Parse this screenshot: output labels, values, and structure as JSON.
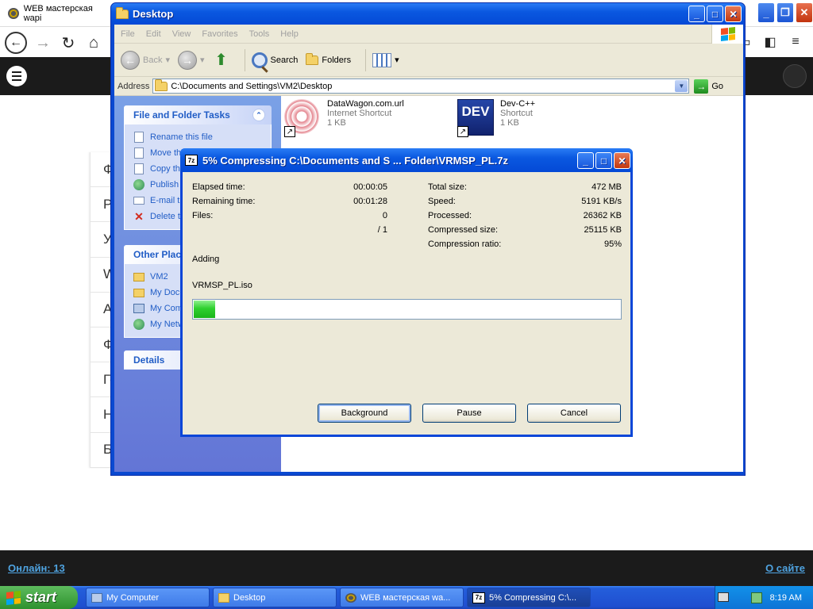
{
  "browser": {
    "tab_title": "WEB мастерская wapi",
    "site_menu_letters": [
      "Ф",
      "Р",
      "У",
      "W",
      "А",
      "Ф",
      "Го",
      "Н",
      "Б"
    ],
    "footer_online": "Онлайн: 13",
    "footer_about": "О сайте"
  },
  "explorer": {
    "title": "Desktop",
    "menu": [
      "File",
      "Edit",
      "View",
      "Favorites",
      "Tools",
      "Help"
    ],
    "toolbar": {
      "back": "Back",
      "search": "Search",
      "folders": "Folders"
    },
    "address_label": "Address",
    "address_value": "C:\\Documents and Settings\\VM2\\Desktop",
    "go": "Go",
    "file_tasks": {
      "header": "File and Folder Tasks",
      "items": [
        {
          "label": "Rename this file",
          "icon": "rename-icon"
        },
        {
          "label": "Move this file",
          "icon": "move-icon"
        },
        {
          "label": "Copy this file",
          "icon": "copy-icon"
        },
        {
          "label": "Publish this file to the Web",
          "icon": "globe-icon"
        },
        {
          "label": "E-mail this file",
          "icon": "mail-icon"
        },
        {
          "label": "Delete this file",
          "icon": "delete-icon"
        }
      ]
    },
    "other_places": {
      "header": "Other Places",
      "items": [
        {
          "label": "VM2",
          "icon": "folder-icon"
        },
        {
          "label": "My Documents",
          "icon": "documents-icon"
        },
        {
          "label": "My Computer",
          "icon": "computer-icon"
        },
        {
          "label": "My Network Places",
          "icon": "network-icon"
        }
      ]
    },
    "details_header": "Details",
    "files": [
      {
        "name": "DataWagon.com.url",
        "type": "Internet Shortcut",
        "size": "1 KB"
      },
      {
        "name": "Dev-C++",
        "type": "Shortcut",
        "size": "1 KB"
      }
    ],
    "dev_icon_text": "DEV"
  },
  "dialog": {
    "title": "5% Compressing C:\\Documents and S ... Folder\\VRMSP_PL.7z",
    "icon_text": "7z",
    "left_stats": [
      {
        "label": "Elapsed time:",
        "value": "00:00:05"
      },
      {
        "label": "Remaining time:",
        "value": "00:01:28"
      },
      {
        "label": "Files:",
        "value": "0"
      },
      {
        "label": "",
        "value": "/ 1"
      }
    ],
    "right_stats": [
      {
        "label": "Total size:",
        "value": "472 MB"
      },
      {
        "label": "Speed:",
        "value": "5191 KB/s"
      },
      {
        "label": "Processed:",
        "value": "26362 KB"
      },
      {
        "label": "Compressed size:",
        "value": "25115 KB"
      },
      {
        "label": "Compression ratio:",
        "value": "95%"
      }
    ],
    "status": "Adding",
    "current_file": "VRMSP_PL.iso",
    "progress_fraction": 0.05,
    "buttons": {
      "background": "Background",
      "pause": "Pause",
      "cancel": "Cancel"
    }
  },
  "taskbar": {
    "start": "start",
    "tasks": [
      {
        "label": "My Computer",
        "active": false
      },
      {
        "label": "Desktop",
        "active": false
      },
      {
        "label": "WEB мастерская wa...",
        "active": false
      },
      {
        "label": "5% Compressing C:\\...",
        "active": true
      }
    ],
    "clock": "8:19 AM"
  },
  "colors": {
    "xp_blue": "#0a58e0",
    "progress_green": "#2fd02f",
    "site_dark": "#1b1b1b",
    "link_blue": "#4fa3e0"
  }
}
